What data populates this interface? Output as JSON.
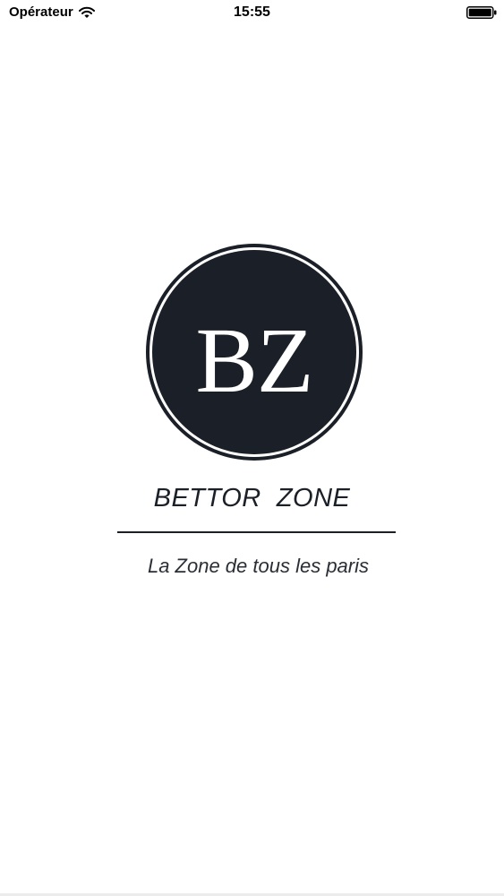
{
  "status_bar": {
    "carrier": "Opérateur",
    "time": "15:55",
    "wifi_icon": "wifi-icon",
    "battery_icon": "battery-icon"
  },
  "logo": {
    "monogram": "BZ",
    "background_color": "#1b1f27",
    "foreground_color": "#ffffff"
  },
  "brand": {
    "name": "BETTOR  ZONE",
    "tagline": "La Zone de tous les paris"
  }
}
